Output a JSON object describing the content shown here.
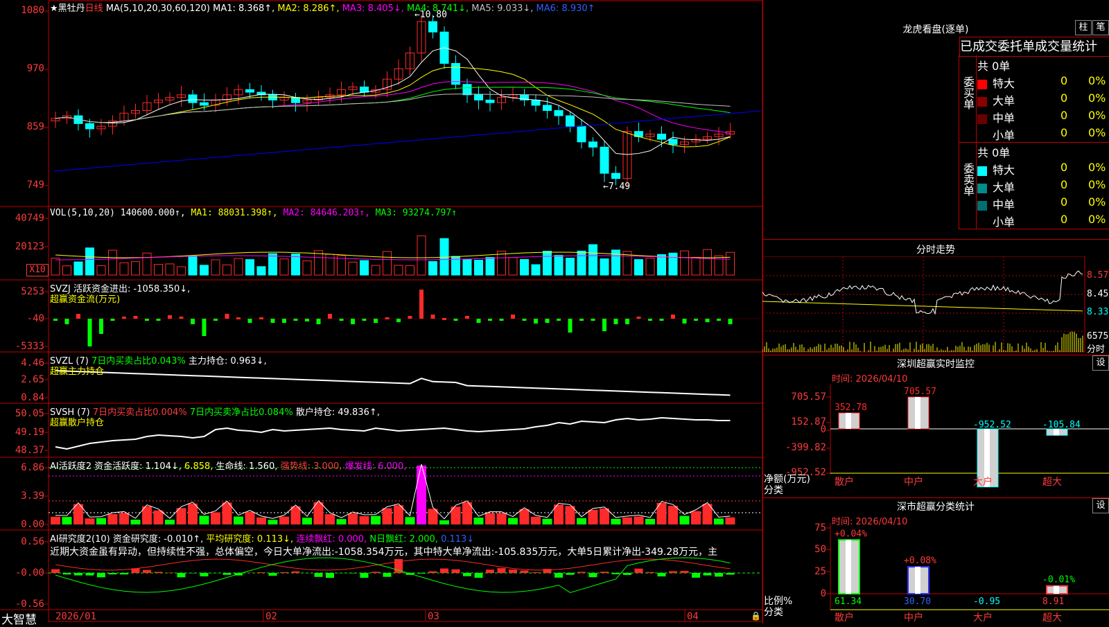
{
  "colors": {
    "up": "#ff2a2a",
    "down": "#00ffff",
    "ma1": "#ffffff",
    "ma2": "#ffff00",
    "ma3": "#ff00ff",
    "ma4": "#00ff00",
    "ma5": "#c0c0c0",
    "ma6": "#0000ff",
    "grid": "#c00000"
  },
  "kline": {
    "star": "★",
    "stock_name": "黑牡丹",
    "period": "日线",
    "ma_params": "MA(5,10,20,30,60,120)",
    "ma1": "MA1: 8.368↑,",
    "ma2": "MA2: 8.286↑,",
    "ma3": "MA3: 8.405↓,",
    "ma4": "MA4: 8.741↓,",
    "ma5": "MA5: 9.033↓,",
    "ma6": "MA6: 8.930↑",
    "y_ticks": [
      "1080",
      "970",
      "859",
      "749"
    ],
    "high_marker": "←10.80",
    "low_marker": "←7.49"
  },
  "vol": {
    "title": "VOL(5,10,20)",
    "value": "140600.000↑,",
    "ma1": "MA1: 88031.398↑,",
    "ma2": "MA2: 84646.203↑,",
    "ma3": "MA3: 93274.797↑",
    "y_ticks": [
      "40749",
      "20123"
    ],
    "unit": "X10"
  },
  "svzj": {
    "title": "SVZJ",
    "desc": "活跃资金进出: -1058.350↓,",
    "sub": "超赢资金流(万元)",
    "y_ticks": [
      "5253",
      "-40",
      "-5333"
    ]
  },
  "svzl": {
    "title": "SVZL (7)",
    "ratio": "7日内买卖占比0.043%",
    "hold": "主力持仓: 0.963↓,",
    "sub": "超赢主力持仓",
    "y_ticks": [
      "4.46",
      "2.65",
      "0.84"
    ]
  },
  "svsh": {
    "title": "SVSH (7)",
    "r1": "7日内买卖占比0.004%",
    "r2": "7日内买卖净占比0.084%",
    "hold": "散户持仓: 49.836↑,",
    "sub": "超赢散户持仓",
    "y_ticks": [
      "50.05",
      "49.19",
      "48.37"
    ]
  },
  "ai_act": {
    "title": "AI活跃度2",
    "a": "资金活跃度: 1.104↓,",
    "b": "6.858,",
    "c": "生命线: 1.560,",
    "d": "强势线: 3.000,",
    "e": "爆发线: 6.000,",
    "y_ticks": [
      "6.86",
      "3.39",
      "0.00"
    ]
  },
  "ai_res": {
    "title": "AI研究度2(10)",
    "a": "资金研究度: -0.010↑,",
    "b": "平均研究度: 0.113↓,",
    "c": "连续飘红: 0.000,",
    "d": "N日飘红: 2.000,",
    "e": "0.113↓",
    "summary": "近期大资金虽有异动，但持续性不强，总体偏空，今日大单净流出:-1058.354万元，其中特大单净流出:-105.835万元，大单5日累计净出-349.28万元，主",
    "y_ticks": [
      "0.56",
      "-0.00",
      "-0.56"
    ]
  },
  "bottom": {
    "brand": "大智慧",
    "dates": [
      "2026/01",
      "02",
      "03",
      "04"
    ]
  },
  "lhb": {
    "title": "龙虎看盘(逐单)",
    "btn_zhu": "柱",
    "btn_bi": "笔",
    "tabs_header": "已成交委托单成交量统计",
    "buy_total": "共 0单",
    "buy_label": "委买单",
    "sell_total": "共 0单",
    "sell_label": "委卖单",
    "buy_rows": [
      {
        "name": "特大",
        "count": "0",
        "pct": "0%",
        "color": "#ff0000"
      },
      {
        "name": "大单",
        "count": "0",
        "pct": "0%",
        "color": "#8b0000"
      },
      {
        "name": "中单",
        "count": "0",
        "pct": "0%",
        "color": "#6b0000"
      },
      {
        "name": "小单",
        "count": "0",
        "pct": "0%",
        "color": ""
      }
    ],
    "sell_rows": [
      {
        "name": "特大",
        "count": "0",
        "pct": "0%",
        "color": "#00ffff"
      },
      {
        "name": "大单",
        "count": "0",
        "pct": "0%",
        "color": "#008b8b"
      },
      {
        "name": "中单",
        "count": "0",
        "pct": "0%",
        "color": "#007070"
      },
      {
        "name": "小单",
        "count": "0",
        "pct": "0%",
        "color": ""
      }
    ]
  },
  "intraday": {
    "title": "分时走势",
    "y_ticks": [
      "8.57",
      "8.45",
      "8.33"
    ],
    "vol_label": "6575",
    "unit": "分时"
  },
  "sz_monitor": {
    "title": "深圳超赢实时监控",
    "btn": "设",
    "time": "时间: 2026/04/10",
    "y_ticks": [
      "705.57",
      "152.87",
      "0",
      "-399.82",
      "-952.52"
    ],
    "axis_name": "净额(万元)",
    "axis_cat": "分类",
    "bars": [
      {
        "name": "散户",
        "value": 352.78,
        "label": "352.78"
      },
      {
        "name": "中户",
        "value": 705.57,
        "label": "705.57"
      },
      {
        "name": "大户",
        "value": -952.52,
        "label": "-952.52"
      },
      {
        "name": "超大",
        "value": -105.84,
        "label": "-105.84"
      }
    ]
  },
  "sz_class": {
    "title": "深市超赢分类统计",
    "btn": "设",
    "time": "时间: 2026/04/10",
    "y_ticks": [
      "75",
      "50",
      "25",
      "0"
    ],
    "axis_name": "比例%",
    "axis_cat": "分类",
    "bars": [
      {
        "name": "散户",
        "value": 61.34,
        "label": "61.34",
        "delta": "+0.04%"
      },
      {
        "name": "中户",
        "value": 30.7,
        "label": "30.70",
        "delta": "+0.08%"
      },
      {
        "name": "大户",
        "value": -0.95,
        "label": "-0.95",
        "delta": ""
      },
      {
        "name": "超大",
        "value": 8.91,
        "label": "8.91",
        "delta": "-0.01%"
      }
    ]
  }
}
